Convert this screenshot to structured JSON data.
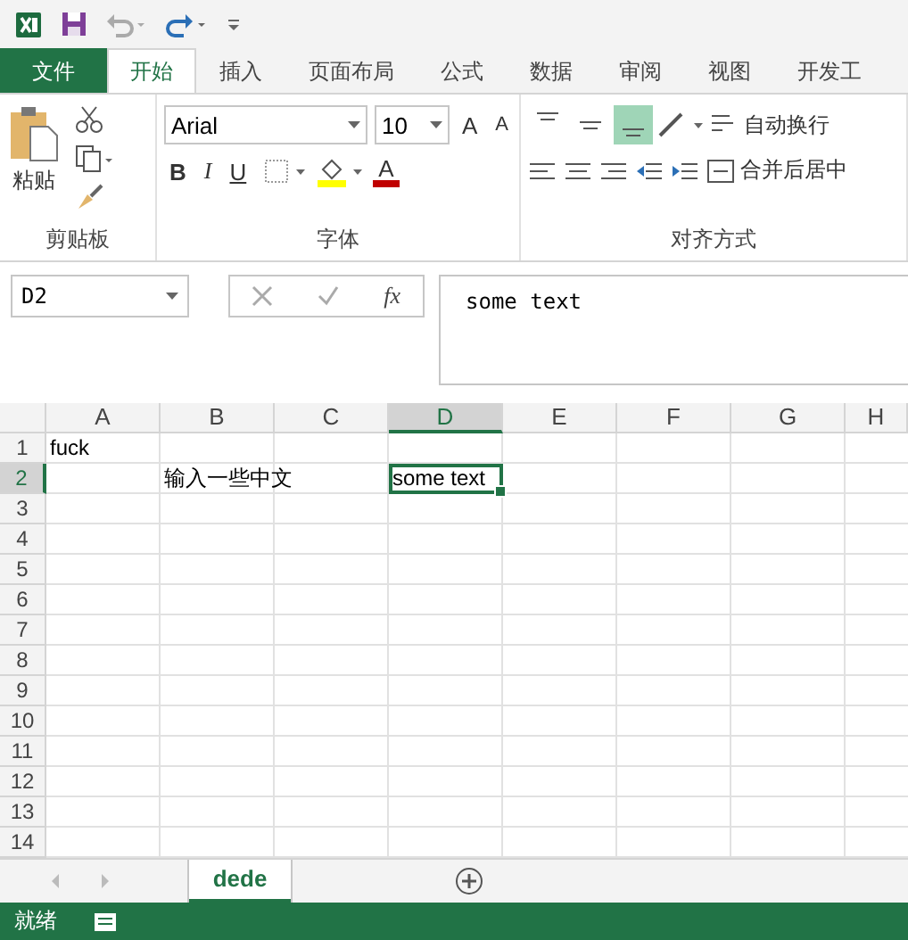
{
  "ribbon_tabs": [
    {
      "label": "文件",
      "kind": "file",
      "selected": false
    },
    {
      "label": "开始",
      "kind": "tab",
      "selected": true
    },
    {
      "label": "插入",
      "kind": "tab",
      "selected": false
    },
    {
      "label": "页面布局",
      "kind": "tab",
      "selected": false
    },
    {
      "label": "公式",
      "kind": "tab",
      "selected": false
    },
    {
      "label": "数据",
      "kind": "tab",
      "selected": false
    },
    {
      "label": "审阅",
      "kind": "tab",
      "selected": false
    },
    {
      "label": "视图",
      "kind": "tab",
      "selected": false
    },
    {
      "label": "开发工",
      "kind": "tab",
      "selected": false
    }
  ],
  "clipboard": {
    "paste_label": "粘贴",
    "group_label": "剪贴板"
  },
  "font": {
    "name": "Arial",
    "size": "10",
    "grow": "A",
    "shrink": "A",
    "bold": "B",
    "italic": "I",
    "underline": "U",
    "color_letter": "A",
    "group_label": "字体"
  },
  "alignment": {
    "vertical": [
      {
        "selected": false
      },
      {
        "selected": false
      },
      {
        "selected": true
      }
    ],
    "wrap_label": "自动换行",
    "merge_label": "合并后居中",
    "group_label": "对齐方式"
  },
  "formula_bar": {
    "name_box": "D2",
    "function_label": "fx",
    "value": "some text"
  },
  "columns": [
    {
      "label": "A",
      "selected": false
    },
    {
      "label": "B",
      "selected": false
    },
    {
      "label": "C",
      "selected": false
    },
    {
      "label": "D",
      "selected": true
    },
    {
      "label": "E",
      "selected": false
    },
    {
      "label": "F",
      "selected": false
    },
    {
      "label": "G",
      "selected": false
    },
    {
      "label": "H",
      "selected": false
    }
  ],
  "rows": [
    {
      "label": "1",
      "selected": false,
      "cells": [
        {
          "text": "fuck",
          "selected": false
        },
        null,
        null,
        null,
        null,
        null,
        null,
        null
      ]
    },
    {
      "label": "2",
      "selected": true,
      "cells": [
        null,
        {
          "text": "输入一些中文",
          "selected": false
        },
        null,
        {
          "text": "some text",
          "selected": true
        },
        null,
        null,
        null,
        null
      ]
    },
    {
      "label": "3",
      "selected": false,
      "cells": []
    },
    {
      "label": "4",
      "selected": false,
      "cells": []
    },
    {
      "label": "5",
      "selected": false,
      "cells": []
    },
    {
      "label": "6",
      "selected": false,
      "cells": []
    },
    {
      "label": "7",
      "selected": false,
      "cells": []
    },
    {
      "label": "8",
      "selected": false,
      "cells": []
    },
    {
      "label": "9",
      "selected": false,
      "cells": []
    },
    {
      "label": "10",
      "selected": false,
      "cells": []
    },
    {
      "label": "11",
      "selected": false,
      "cells": []
    },
    {
      "label": "12",
      "selected": false,
      "cells": []
    },
    {
      "label": "13",
      "selected": false,
      "cells": []
    },
    {
      "label": "14",
      "selected": false,
      "cells": []
    }
  ],
  "sheet_tabs": [
    {
      "label": "dede",
      "selected": true
    }
  ],
  "status_bar": {
    "text": "就绪"
  }
}
